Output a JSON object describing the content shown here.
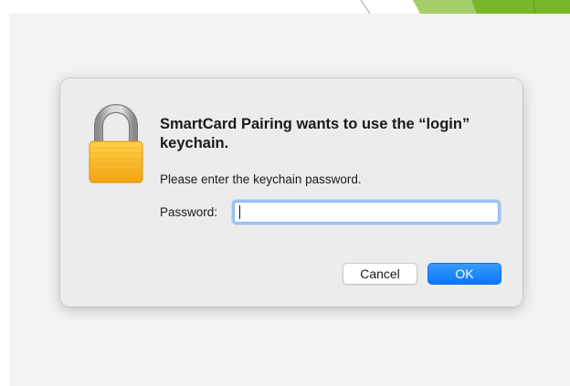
{
  "dialog": {
    "title": "SmartCard Pairing wants to use the “login” keychain.",
    "message": "Please enter the keychain password.",
    "password_label": "Password:",
    "password_value": "",
    "icon": "lock-icon",
    "buttons": {
      "cancel_label": "Cancel",
      "ok_label": "OK"
    }
  },
  "colors": {
    "accent": "#1a84f8",
    "backdrop": "#f2f2f2",
    "dialog_background": "#ececec",
    "lock_body": "#f7b81c",
    "decoration_green": "#76b82a"
  }
}
